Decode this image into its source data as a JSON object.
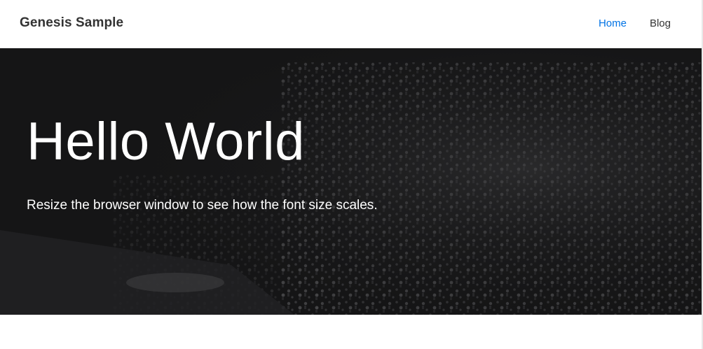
{
  "header": {
    "site_title": "Genesis Sample",
    "nav": [
      {
        "label": "Home",
        "current": true
      },
      {
        "label": "Blog",
        "current": false
      }
    ]
  },
  "hero": {
    "title": "Hello World",
    "subtitle": "Resize the browser window to see how the font size scales."
  },
  "colors": {
    "accent": "#0073e5",
    "hero_bg": "#151516",
    "text": "#333333"
  }
}
